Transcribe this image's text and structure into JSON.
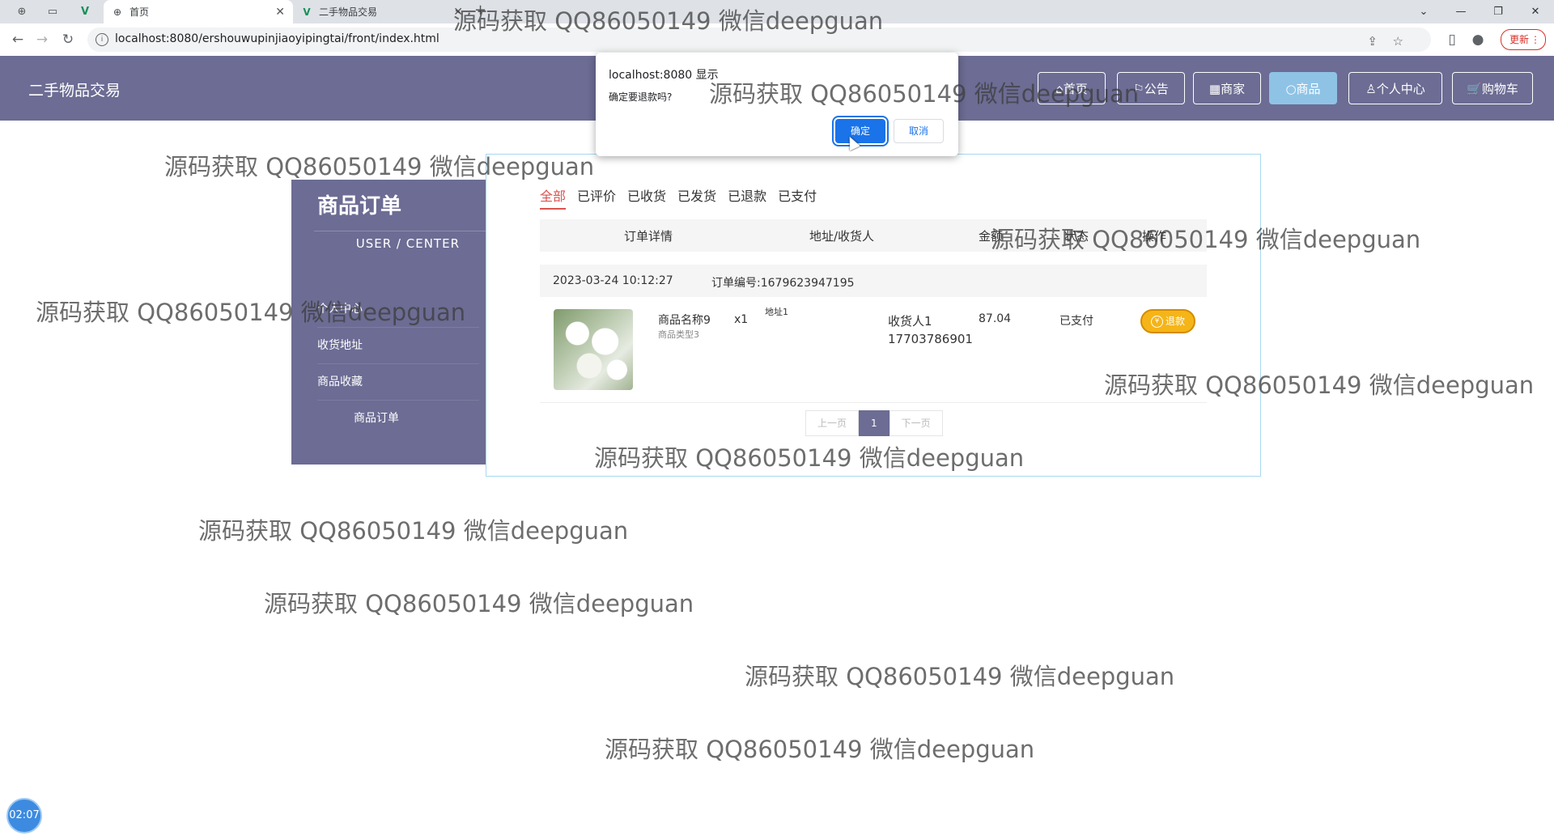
{
  "browser": {
    "tabs": [
      {
        "title": "首页",
        "active": true
      },
      {
        "title": "二手物品交易",
        "active": false
      }
    ],
    "url": "localhost:8080/ershouwupinjiaoyipingtai/front/index.html",
    "update_label": "更新"
  },
  "site": {
    "title": "二手物品交易",
    "nav": [
      {
        "label": "首页",
        "icon": "home-icon"
      },
      {
        "label": "公告",
        "icon": "flag-icon"
      },
      {
        "label": "商家",
        "icon": "store-icon"
      },
      {
        "label": "商品",
        "icon": "goods-icon",
        "active": true
      },
      {
        "label": "个人中心",
        "icon": "user-icon"
      },
      {
        "label": "购物车",
        "icon": "cart-icon"
      }
    ]
  },
  "sidebar": {
    "title": "商品订单",
    "subtitle": "USER / CENTER",
    "items": [
      {
        "label": "个人中心"
      },
      {
        "label": "收货地址"
      },
      {
        "label": "商品收藏"
      },
      {
        "label": "商品订单"
      }
    ]
  },
  "orders": {
    "tabs": [
      "全部",
      "已评价",
      "已收货",
      "已发货",
      "已退款",
      "已支付"
    ],
    "active_tab": "全部",
    "columns": [
      "订单详情",
      "地址/收货人",
      "金额",
      "状态",
      "操作"
    ],
    "list": [
      {
        "time": "2023-03-24 10:12:27",
        "order_no": "订单编号:1679623947195",
        "product_name": "商品名称9",
        "product_type": "商品类型3",
        "quantity": "x1",
        "address": "地址1",
        "receiver": "收货人1",
        "phone": "17703786901",
        "amount": "87.04",
        "status": "已支付",
        "action": "退款"
      }
    ],
    "pager": {
      "prev": "上一页",
      "current": "1",
      "next": "下一页"
    }
  },
  "dialog": {
    "title": "localhost:8080 显示",
    "message": "确定要退款吗?",
    "ok": "确定",
    "cancel": "取消"
  },
  "watermark": "源码获取 QQ86050149 微信deepguan",
  "timer": "02:07"
}
